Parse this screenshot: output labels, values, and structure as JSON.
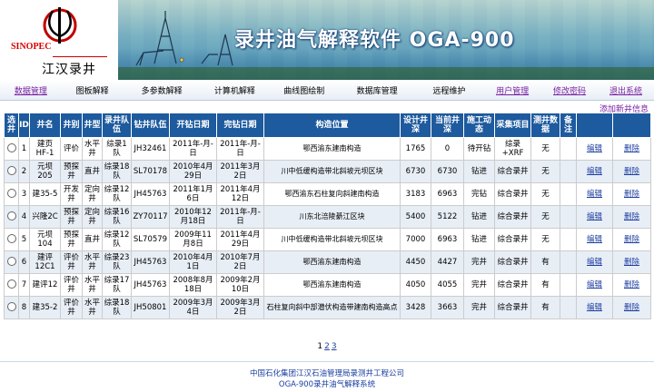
{
  "brand": {
    "logo_sub": "SINOPEC",
    "logo_cn": "江汉录井",
    "title": "录井油气解释软件 OGA-900"
  },
  "nav": [
    {
      "label": "数据管理",
      "hl": true
    },
    {
      "label": "图板解释",
      "hl": false
    },
    {
      "label": "多参数解释",
      "hl": false
    },
    {
      "label": "计算机解释",
      "hl": false
    },
    {
      "label": "曲线图绘制",
      "hl": false
    },
    {
      "label": "数据库管理",
      "hl": false
    },
    {
      "label": "远程维护",
      "hl": false
    },
    {
      "label": "用户管理",
      "hl": true
    },
    {
      "label": "修改密码",
      "hl": true
    },
    {
      "label": "退出系统",
      "hl": true
    }
  ],
  "add_link": "添加新井信息",
  "columns": [
    "选井",
    "ID",
    "井名",
    "井别",
    "井型",
    "录井队伍",
    "钻井队伍",
    "开钻日期",
    "完钻日期",
    "构造位置",
    "设计井深",
    "当前井深",
    "施工动态",
    "采集项目",
    "测井数据",
    "备注",
    "",
    ""
  ],
  "rows": [
    {
      "id": "1",
      "name": "建页HF-1",
      "type": "评价",
      "shape": "水平井",
      "logteam": "综录1队",
      "drillteam": "JH32461",
      "start": "2011年-月-日",
      "end": "2011年-月-日",
      "location": "鄂西渝东建南构造",
      "design": "1765",
      "current": "0",
      "status": "待开钻",
      "items": "综录+XRF",
      "logdata": "无",
      "note": "",
      "edit": "编辑",
      "del": "删除"
    },
    {
      "id": "2",
      "name": "元坝205",
      "type": "预探井",
      "shape": "直井",
      "logteam": "综录18队",
      "drillteam": "SL70178",
      "start": "2010年4月29日",
      "end": "2011年3月2日",
      "location": "川中低缓构造带北斜坡元坝区块",
      "design": "6730",
      "current": "6730",
      "status": "钻进",
      "items": "综合录井",
      "logdata": "无",
      "note": "",
      "edit": "编辑",
      "del": "删除"
    },
    {
      "id": "3",
      "name": "建35-5",
      "type": "开发井",
      "shape": "定向井",
      "logteam": "综录12队",
      "drillteam": "JH45763",
      "start": "2011年1月6日",
      "end": "2011年4月12日",
      "location": "鄂西渝东石柱复向斜建南构造",
      "design": "3183",
      "current": "6963",
      "status": "完钻",
      "items": "综合录井",
      "logdata": "无",
      "note": "",
      "edit": "编辑",
      "del": "删除"
    },
    {
      "id": "4",
      "name": "兴隆2C",
      "type": "预探井",
      "shape": "定向井",
      "logteam": "综录16队",
      "drillteam": "ZY70117",
      "start": "2010年12月18日",
      "end": "2011年-月-日",
      "location": "川东北涪陵綦江区块",
      "design": "5400",
      "current": "5122",
      "status": "钻进",
      "items": "综合录井",
      "logdata": "无",
      "note": "",
      "edit": "编辑",
      "del": "删除"
    },
    {
      "id": "5",
      "name": "元坝104",
      "type": "预探井",
      "shape": "直井",
      "logteam": "综录12队",
      "drillteam": "SL70579",
      "start": "2009年11月8日",
      "end": "2011年4月29日",
      "location": "川中低缓构造带北斜坡元坝区块",
      "design": "7000",
      "current": "6963",
      "status": "钻进",
      "items": "综合录井",
      "logdata": "无",
      "note": "",
      "edit": "编辑",
      "del": "删除"
    },
    {
      "id": "6",
      "name": "建评12C1",
      "type": "评价井",
      "shape": "水平井",
      "logteam": "综录23队",
      "drillteam": "JH45763",
      "start": "2010年4月1日",
      "end": "2010年7月2日",
      "location": "鄂西渝东建南构造",
      "design": "4450",
      "current": "4427",
      "status": "完井",
      "items": "综合录井",
      "logdata": "有",
      "note": "",
      "edit": "编辑",
      "del": "删除"
    },
    {
      "id": "7",
      "name": "建评12",
      "type": "评价井",
      "shape": "水平井",
      "logteam": "综录17队",
      "drillteam": "JH45763",
      "start": "2008年8月18日",
      "end": "2009年2月10日",
      "location": "鄂西渝东建南构造",
      "design": "4050",
      "current": "4055",
      "status": "完井",
      "items": "综合录井",
      "logdata": "有",
      "note": "",
      "edit": "编辑",
      "del": "删除"
    },
    {
      "id": "8",
      "name": "建35-2",
      "type": "评价井",
      "shape": "水平井",
      "logteam": "综录18队",
      "drillteam": "JH50801",
      "start": "2009年3月4日",
      "end": "2009年3月2日",
      "location": "石柱复向斜中部潜伏构造带建南构造高点",
      "design": "3428",
      "current": "3663",
      "status": "完井",
      "items": "综合录井",
      "logdata": "有",
      "note": "",
      "edit": "编辑",
      "del": "删除"
    }
  ],
  "pager": [
    "1",
    "2",
    "3"
  ],
  "footer": {
    "line1": "中国石化集团江汉石油管理局录测井工程公司",
    "line2": "OGA-900录井油气解释系统"
  }
}
